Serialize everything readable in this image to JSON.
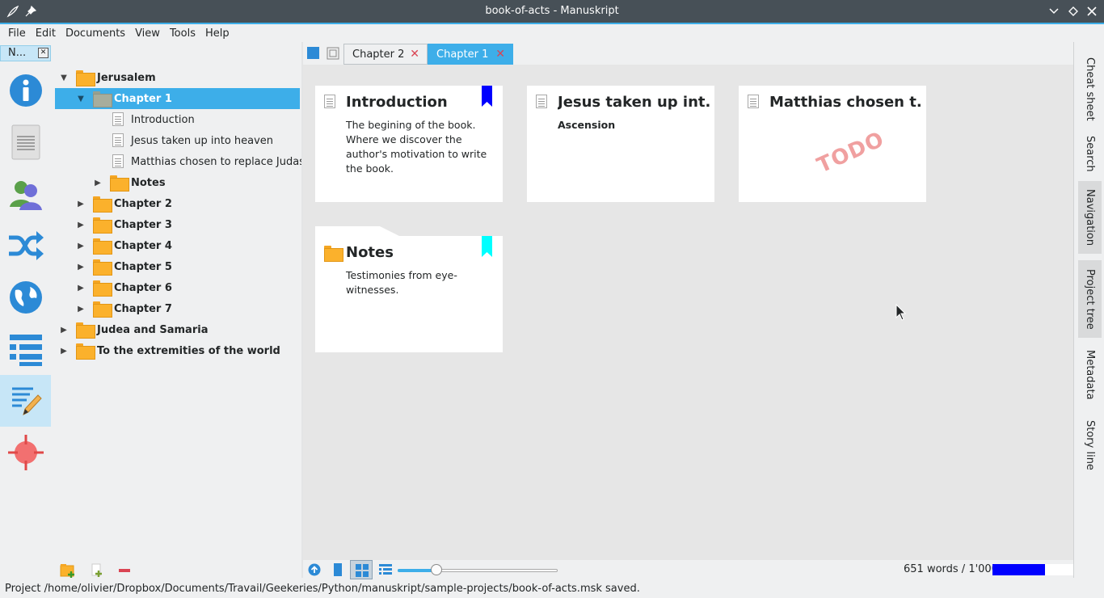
{
  "window": {
    "title": "book-of-acts - Manuskript"
  },
  "menu": [
    "File",
    "Edit",
    "Documents",
    "View",
    "Tools",
    "Help"
  ],
  "dock": {
    "label": "N..."
  },
  "tree": {
    "root": "Jerusalem",
    "selected": "Chapter 1",
    "children": [
      "Introduction",
      "Jesus taken up into heaven",
      "Matthias chosen to replace Judas"
    ],
    "subfolder": "Notes",
    "chapters": [
      "Chapter 2",
      "Chapter 3",
      "Chapter 4",
      "Chapter 5",
      "Chapter 6",
      "Chapter 7"
    ],
    "parts": [
      "Judea and Samaria",
      "To the extremities of the world"
    ]
  },
  "tabs": [
    {
      "label": "Chapter 2"
    },
    {
      "label": "Chapter 1"
    }
  ],
  "cards": [
    {
      "title": "Introduction",
      "summary": "The begining of the book. Where we discover the author's motivation to write the book.",
      "bookmark_color": "#0000ff"
    },
    {
      "title": "Jesus taken up int...",
      "summary": "Ascension"
    },
    {
      "title": "Matthias chosen t...",
      "stamp": "TODO"
    },
    {
      "title": "Notes",
      "summary": "Testimonies from eye-witnesses.",
      "bookmark_color": "#00ffff"
    }
  ],
  "slider": {
    "value": 0.24
  },
  "wordcount": {
    "text": "651 words / 1'000",
    "progress": 0.651,
    "color": "#0000ff"
  },
  "right_tabs": [
    "Cheat sheet",
    "Search",
    "Navigation",
    "Project tree",
    "Metadata",
    "Story line"
  ],
  "status": "Project /home/olivier/Dropbox/Documents/Travail/Geekeries/Python/manuskript/sample-projects/book-of-acts.msk saved.",
  "colors": {
    "accent": "#3daee9",
    "titlebar": "#475057"
  }
}
